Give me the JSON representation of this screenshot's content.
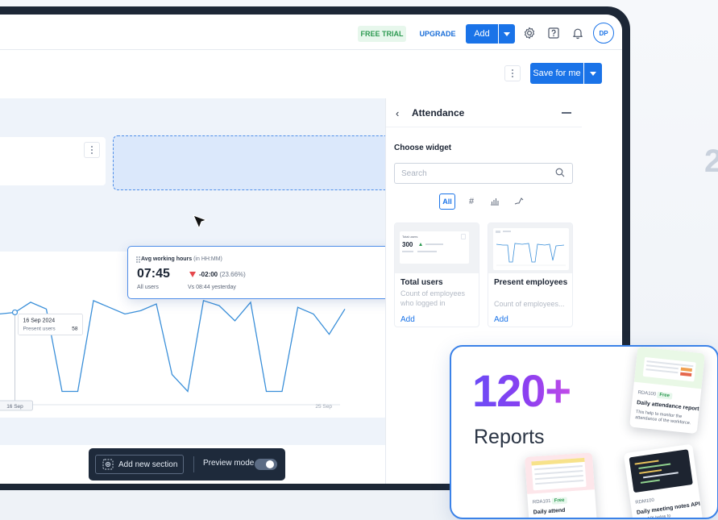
{
  "topbar": {
    "free_trial": "FREE TRIAL",
    "upgrade": "UPGRADE",
    "add": "Add",
    "avatar": "DP"
  },
  "subbar": {
    "save": "Save for me"
  },
  "widget": {
    "title": "Avg working hours",
    "title_unit": "(in HH:MM)",
    "value": "07:45",
    "delta": "-02:00",
    "delta_pct": "(23.66%)",
    "scope": "All users",
    "compare": "Vs 08:44 yesterday",
    "delta_color": "#e5484d"
  },
  "chart_data": {
    "type": "line",
    "series": [
      {
        "values": [
          45,
          60,
          52,
          53,
          59,
          55,
          6,
          6,
          60,
          56,
          52,
          54,
          58,
          16,
          6,
          60,
          57,
          48,
          59,
          6,
          6,
          56,
          52,
          40,
          55
        ]
      }
    ],
    "tooltip": {
      "date": "16 Sep 2024",
      "label": "Present users",
      "value": "58"
    },
    "x_ticks": [
      "16 Sep",
      "25 Sep"
    ],
    "ylim": [
      0,
      70
    ],
    "line_color": "#3a8fd9"
  },
  "toolbar": {
    "add_section": "Add new section",
    "preview": "Preview mode"
  },
  "side_panel": {
    "title": "Attendance",
    "choose": "Choose widget",
    "search_placeholder": "Search",
    "filters": [
      "All",
      "#"
    ],
    "cards": [
      {
        "name": "Total users",
        "desc": "Count of employees who logged in",
        "add": "Add",
        "thumb_label": "Total users",
        "thumb_value": "300"
      },
      {
        "name": "Present employees",
        "desc": "Count of employees...",
        "add": "Add"
      }
    ]
  },
  "promo": {
    "number": "120+",
    "label": "Reports",
    "doc1": {
      "tag": "RDA100",
      "free": "Free",
      "title": "Daily attendance report",
      "desc": "This help to monitor the attendance of the workforce."
    },
    "doc2": {
      "tag": "RDA101",
      "free": "Free",
      "title": "Daily attend"
    },
    "doc3": {
      "tag": "RDM100",
      "title": "Daily meeting notes API",
      "desc": "This API helps to"
    }
  },
  "edge_number": "2"
}
